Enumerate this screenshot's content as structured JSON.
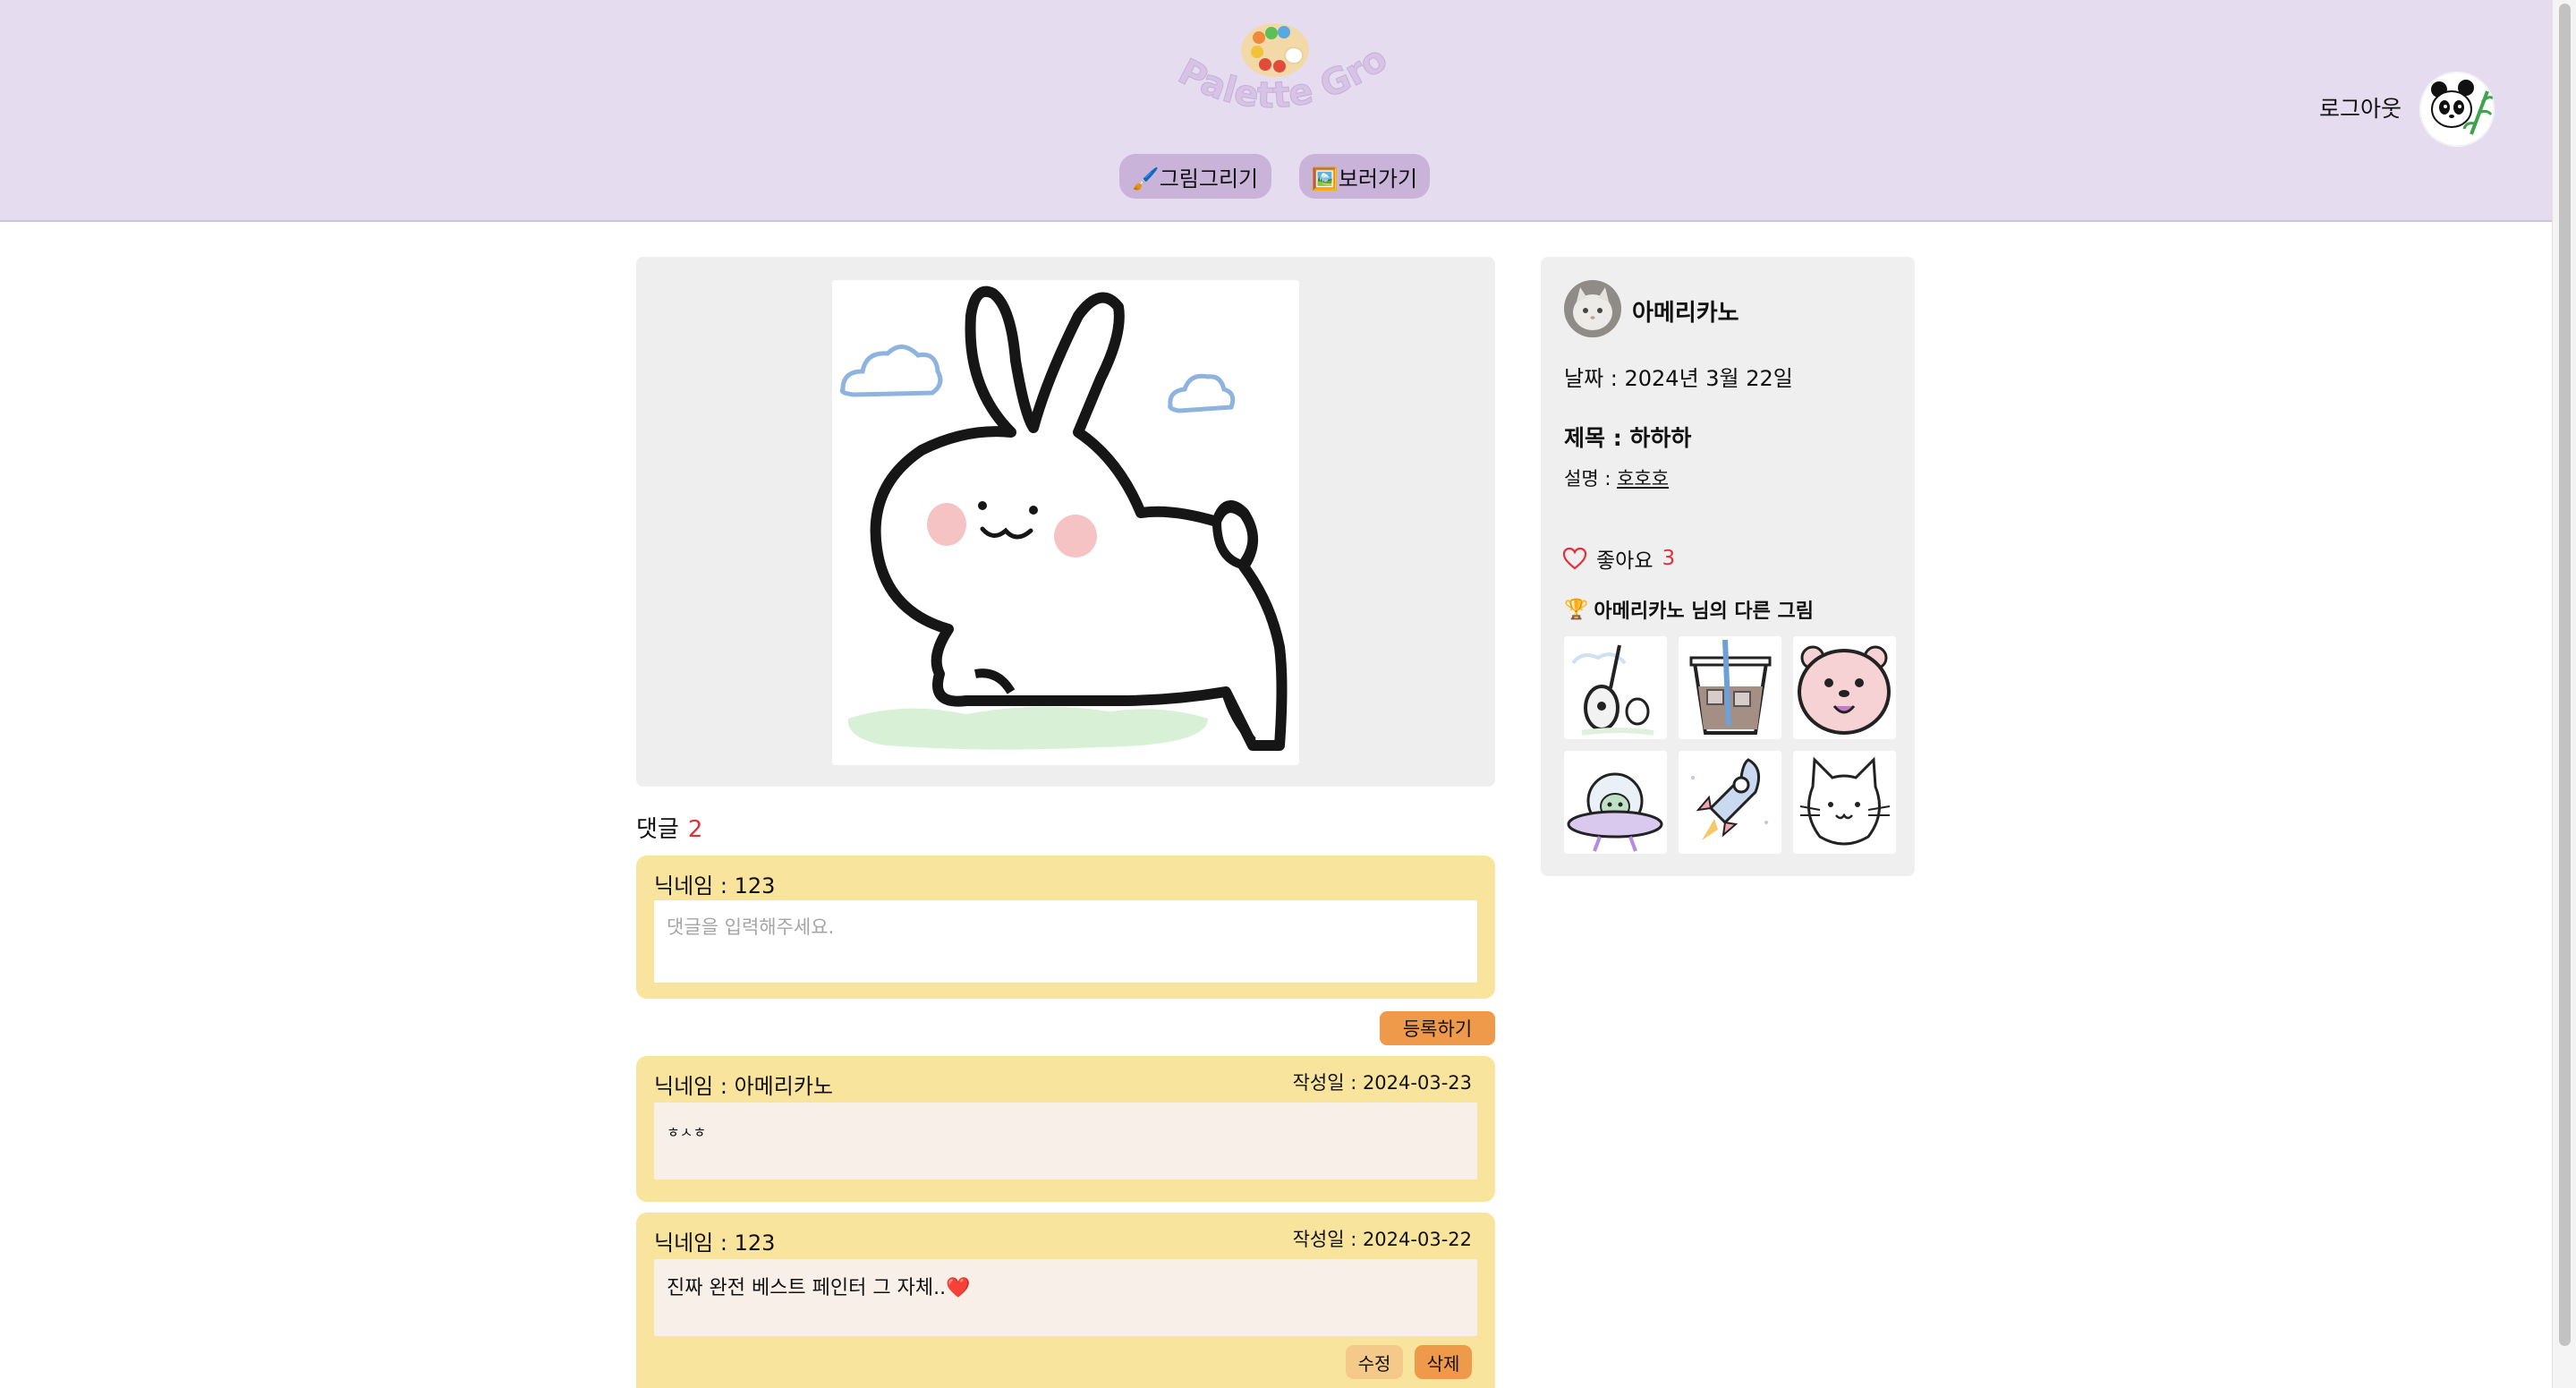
{
  "header": {
    "logo_text": "Palette Ground",
    "nav": [
      {
        "label": "🖌️그림그리기"
      },
      {
        "label": "🖼️보러가기"
      }
    ],
    "logout_label": "로그아웃"
  },
  "comments": {
    "heading": "댓글",
    "count": "2",
    "new_comment": {
      "nickname": "닉네임 : 123",
      "placeholder": "댓글을 입력해주세요."
    },
    "register_label": "등록하기",
    "items": [
      {
        "nickname": "닉네임 : 아메리카노",
        "date": "작성일 : 2024-03-23",
        "text": "ㅎㅅㅎ"
      },
      {
        "nickname": "닉네임 : 123",
        "date": "작성일 : 2024-03-22",
        "text": "진짜 완전 베스트 페인터 그 자체..❤️",
        "edit_label": "수정",
        "delete_label": "삭제"
      }
    ]
  },
  "info": {
    "author": "아메리카노",
    "date": "날짜 : 2024년 3월 22일",
    "title": "제목 : 하하하",
    "desc_label": "설명 : ",
    "desc_value": "호호호",
    "like_label": "좋아요",
    "like_count": "3",
    "other_title": "아메리카노 님의 다른 그림",
    "other_icon": "🏆"
  },
  "colors": {
    "header_bg": "#e5ddef",
    "nav_button": "#c9b3d9",
    "comment_box": "#f9e49e",
    "accent_orange": "#ef9a4b",
    "count_red": "#e0303b"
  }
}
